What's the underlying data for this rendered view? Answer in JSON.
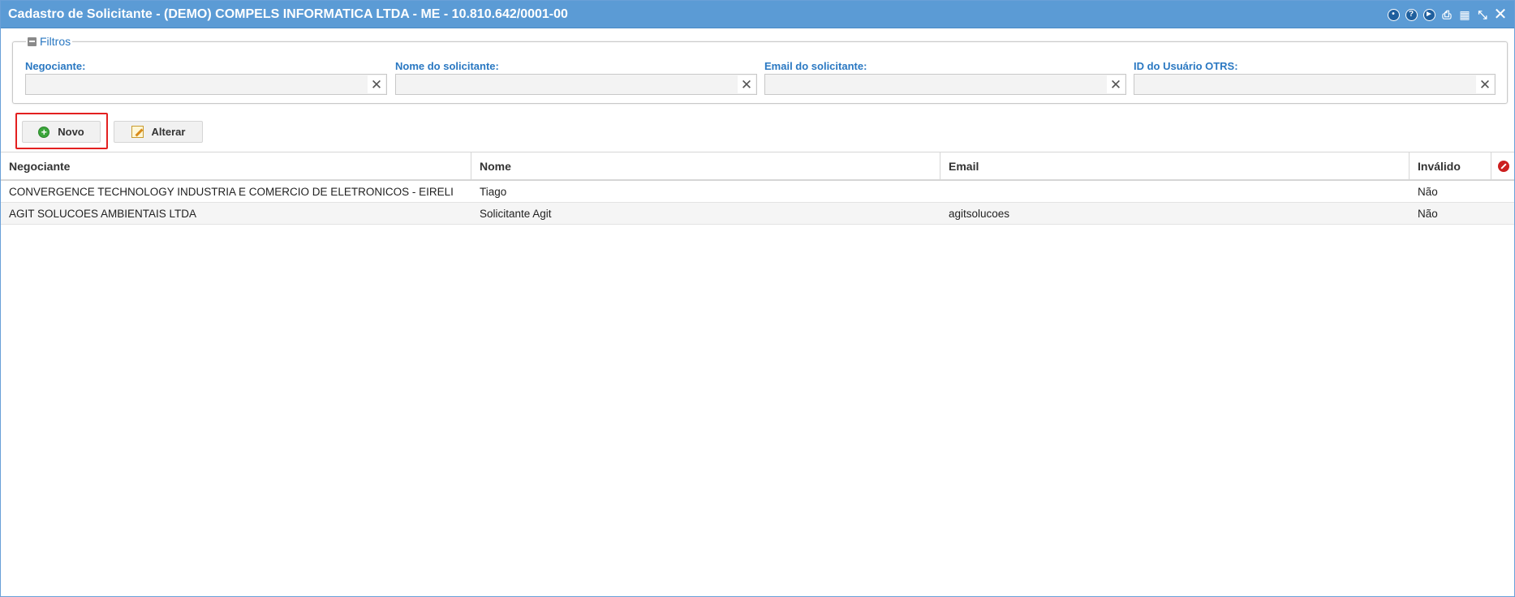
{
  "window": {
    "title": "Cadastro de Solicitante - (DEMO) COMPELS INFORMATICA LTDA - ME - 10.810.642/0001-00",
    "tools": [
      "settings-icon",
      "help-icon",
      "play-icon",
      "print-icon",
      "calendar-icon",
      "collapse-icon",
      "close-icon"
    ]
  },
  "filters": {
    "legend": "Filtros",
    "fields": [
      {
        "label": "Negociante:",
        "value": ""
      },
      {
        "label": "Nome do solicitante:",
        "value": ""
      },
      {
        "label": "Email do solicitante:",
        "value": ""
      },
      {
        "label": "ID do Usuário OTRS:",
        "value": ""
      }
    ]
  },
  "toolbar": {
    "new_label": "Novo",
    "edit_label": "Alterar"
  },
  "grid": {
    "columns": [
      "Negociante",
      "Nome",
      "Email",
      "Inválido"
    ],
    "rows": [
      {
        "negociante": "CONVERGENCE TECHNOLOGY INDUSTRIA E COMERCIO DE ELETRONICOS - EIRELI",
        "nome": "Tiago",
        "email": "",
        "invalido": "Não"
      },
      {
        "negociante": "AGIT SOLUCOES AMBIENTAIS LTDA",
        "nome": "Solicitante Agit",
        "email": "agitsolucoes",
        "invalido": "Não"
      }
    ]
  },
  "colors": {
    "titlebar": "#5b9bd5",
    "label_blue": "#2a78c2",
    "highlight_red": "#e32020"
  }
}
